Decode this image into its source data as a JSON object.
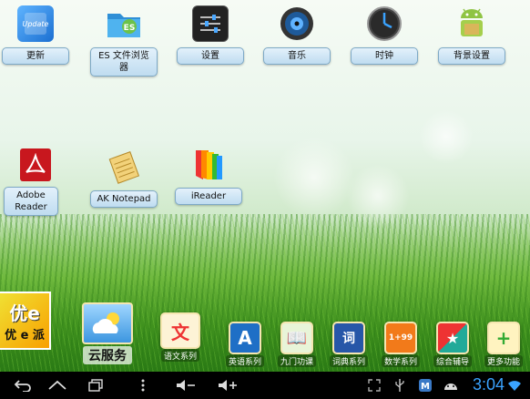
{
  "desktop": {
    "row1": [
      {
        "id": "update",
        "label": "更新",
        "icon": "update-icon",
        "badge": "Update"
      },
      {
        "id": "es",
        "label": "ES 文件浏览器",
        "icon": "folder-icon",
        "badge": "ES"
      },
      {
        "id": "settings",
        "label": "设置",
        "icon": "settings-sliders-icon"
      },
      {
        "id": "music",
        "label": "音乐",
        "icon": "speaker-icon"
      },
      {
        "id": "clock",
        "label": "时钟",
        "icon": "clock-icon"
      },
      {
        "id": "wallpaper",
        "label": "背景设置",
        "icon": "android-icon"
      }
    ],
    "row2": [
      {
        "id": "adobe",
        "label": "Adobe Reader",
        "icon": "adobe-reader-icon"
      },
      {
        "id": "aknotepad",
        "label": "AK Notepad",
        "icon": "notepad-icon"
      },
      {
        "id": "ireader",
        "label": "iReader",
        "icon": "ireader-books-icon"
      }
    ]
  },
  "dock": {
    "youepai": {
      "label": "优 e 派",
      "logo": "优e"
    },
    "cloud": {
      "label": "云服务"
    },
    "items": [
      {
        "id": "chinese",
        "label": "语文系列",
        "icon": "chinese-runner-icon",
        "glyph": "文"
      },
      {
        "id": "english",
        "label": "英语系列",
        "icon": "english-a-icon",
        "glyph": "A"
      },
      {
        "id": "ninedoor",
        "label": "九门功课",
        "icon": "book-icon",
        "glyph": "📖"
      },
      {
        "id": "dictionary",
        "label": "词典系列",
        "icon": "dictionary-icon",
        "glyph": "词"
      },
      {
        "id": "math",
        "label": "数学系列",
        "icon": "math-icon",
        "glyph": "1+99"
      },
      {
        "id": "tutor",
        "label": "综合辅导",
        "icon": "tutor-icon",
        "glyph": "★"
      },
      {
        "id": "more",
        "label": "更多功能",
        "icon": "more-functions-icon",
        "glyph": "+"
      }
    ]
  },
  "statusbar": {
    "time": "3:04"
  },
  "colors": {
    "label_bg": "#cfe5f5",
    "clock": "#3aa3ff"
  }
}
